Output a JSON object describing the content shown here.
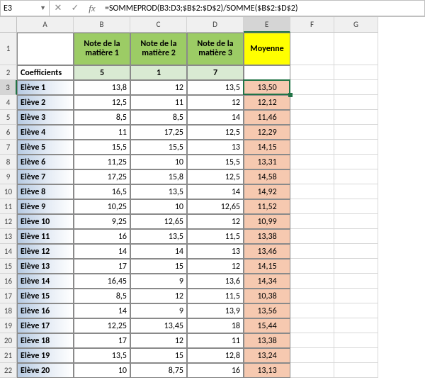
{
  "name_box": "E3",
  "formula": "=SOMMEPROD(B3:D3;$B$2:$D$2)/SOMME($B$2:$D$2)",
  "columns": [
    "A",
    "B",
    "C",
    "D",
    "E",
    "F",
    "G"
  ],
  "row_numbers": [
    1,
    2,
    3,
    4,
    5,
    6,
    7,
    8,
    9,
    10,
    11,
    12,
    13,
    14,
    15,
    16,
    17,
    18,
    19,
    20,
    21,
    22
  ],
  "headers": {
    "a1": "",
    "b1": "Note de la matière 1",
    "c1": "Note de la matière 2",
    "d1": "Note de la matière 3",
    "e1": "Moyenne",
    "a2": "Coefficients",
    "coef": [
      "5",
      "1",
      "7"
    ]
  },
  "students": [
    {
      "name": "Elève 1",
      "n1": "13,8",
      "n2": "12",
      "n3": "13,5",
      "avg": "13,50"
    },
    {
      "name": "Elève 2",
      "n1": "12,5",
      "n2": "11",
      "n3": "12",
      "avg": "12,12"
    },
    {
      "name": "Elève 3",
      "n1": "8,5",
      "n2": "8,5",
      "n3": "14",
      "avg": "11,46"
    },
    {
      "name": "Elève 4",
      "n1": "11",
      "n2": "17,25",
      "n3": "12,5",
      "avg": "12,29"
    },
    {
      "name": "Elève 5",
      "n1": "15,5",
      "n2": "15,5",
      "n3": "13",
      "avg": "14,15"
    },
    {
      "name": "Elève 6",
      "n1": "11,25",
      "n2": "10",
      "n3": "15,5",
      "avg": "13,31"
    },
    {
      "name": "Elève 7",
      "n1": "17,25",
      "n2": "15,8",
      "n3": "12,5",
      "avg": "14,58"
    },
    {
      "name": "Elève 8",
      "n1": "16,5",
      "n2": "13,5",
      "n3": "14",
      "avg": "14,92"
    },
    {
      "name": "Elève 9",
      "n1": "10,25",
      "n2": "10",
      "n3": "12,65",
      "avg": "11,52"
    },
    {
      "name": "Elève 10",
      "n1": "9,25",
      "n2": "12,65",
      "n3": "12",
      "avg": "10,99"
    },
    {
      "name": "Elève 11",
      "n1": "16",
      "n2": "13,5",
      "n3": "11,5",
      "avg": "13,38"
    },
    {
      "name": "Elève 12",
      "n1": "14",
      "n2": "14",
      "n3": "13",
      "avg": "13,46"
    },
    {
      "name": "Elève 13",
      "n1": "17",
      "n2": "15",
      "n3": "12",
      "avg": "14,15"
    },
    {
      "name": "Elève 14",
      "n1": "16,45",
      "n2": "9",
      "n3": "13,6",
      "avg": "14,34"
    },
    {
      "name": "Elève 15",
      "n1": "8,5",
      "n2": "12",
      "n3": "11,5",
      "avg": "10,38"
    },
    {
      "name": "Elève 16",
      "n1": "14",
      "n2": "9",
      "n3": "13,9",
      "avg": "13,56"
    },
    {
      "name": "Elève 17",
      "n1": "12,25",
      "n2": "13,45",
      "n3": "18",
      "avg": "15,44"
    },
    {
      "name": "Elève 18",
      "n1": "17",
      "n2": "12",
      "n3": "11",
      "avg": "13,38"
    },
    {
      "name": "Elève 19",
      "n1": "13,5",
      "n2": "15",
      "n3": "12,8",
      "avg": "13,24"
    },
    {
      "name": "Elève 20",
      "n1": "10",
      "n2": "8,75",
      "n3": "16",
      "avg": "13,13"
    }
  ],
  "chart_data": {
    "type": "table",
    "title": "",
    "columns": [
      "Note de la matière 1",
      "Note de la matière 2",
      "Note de la matière 3",
      "Moyenne"
    ],
    "coefficients": [
      5,
      1,
      7
    ],
    "rows": [
      {
        "label": "Elève 1",
        "values": [
          13.8,
          12,
          13.5,
          13.5
        ]
      },
      {
        "label": "Elève 2",
        "values": [
          12.5,
          11,
          12,
          12.12
        ]
      },
      {
        "label": "Elève 3",
        "values": [
          8.5,
          8.5,
          14,
          11.46
        ]
      },
      {
        "label": "Elève 4",
        "values": [
          11,
          17.25,
          12.5,
          12.29
        ]
      },
      {
        "label": "Elève 5",
        "values": [
          15.5,
          15.5,
          13,
          14.15
        ]
      },
      {
        "label": "Elève 6",
        "values": [
          11.25,
          10,
          15.5,
          13.31
        ]
      },
      {
        "label": "Elève 7",
        "values": [
          17.25,
          15.8,
          12.5,
          14.58
        ]
      },
      {
        "label": "Elève 8",
        "values": [
          16.5,
          13.5,
          14,
          14.92
        ]
      },
      {
        "label": "Elève 9",
        "values": [
          10.25,
          10,
          12.65,
          11.52
        ]
      },
      {
        "label": "Elève 10",
        "values": [
          9.25,
          12.65,
          12,
          10.99
        ]
      },
      {
        "label": "Elève 11",
        "values": [
          16,
          13.5,
          11.5,
          13.38
        ]
      },
      {
        "label": "Elève 12",
        "values": [
          14,
          14,
          13,
          13.46
        ]
      },
      {
        "label": "Elève 13",
        "values": [
          17,
          15,
          12,
          14.15
        ]
      },
      {
        "label": "Elève 14",
        "values": [
          16.45,
          9,
          13.6,
          14.34
        ]
      },
      {
        "label": "Elève 15",
        "values": [
          8.5,
          12,
          11.5,
          10.38
        ]
      },
      {
        "label": "Elève 16",
        "values": [
          14,
          9,
          13.9,
          13.56
        ]
      },
      {
        "label": "Elève 17",
        "values": [
          12.25,
          13.45,
          18,
          15.44
        ]
      },
      {
        "label": "Elève 18",
        "values": [
          17,
          12,
          11,
          13.38
        ]
      },
      {
        "label": "Elève 19",
        "values": [
          13.5,
          15,
          12.8,
          13.24
        ]
      },
      {
        "label": "Elève 20",
        "values": [
          10,
          8.75,
          16,
          13.13
        ]
      }
    ]
  }
}
